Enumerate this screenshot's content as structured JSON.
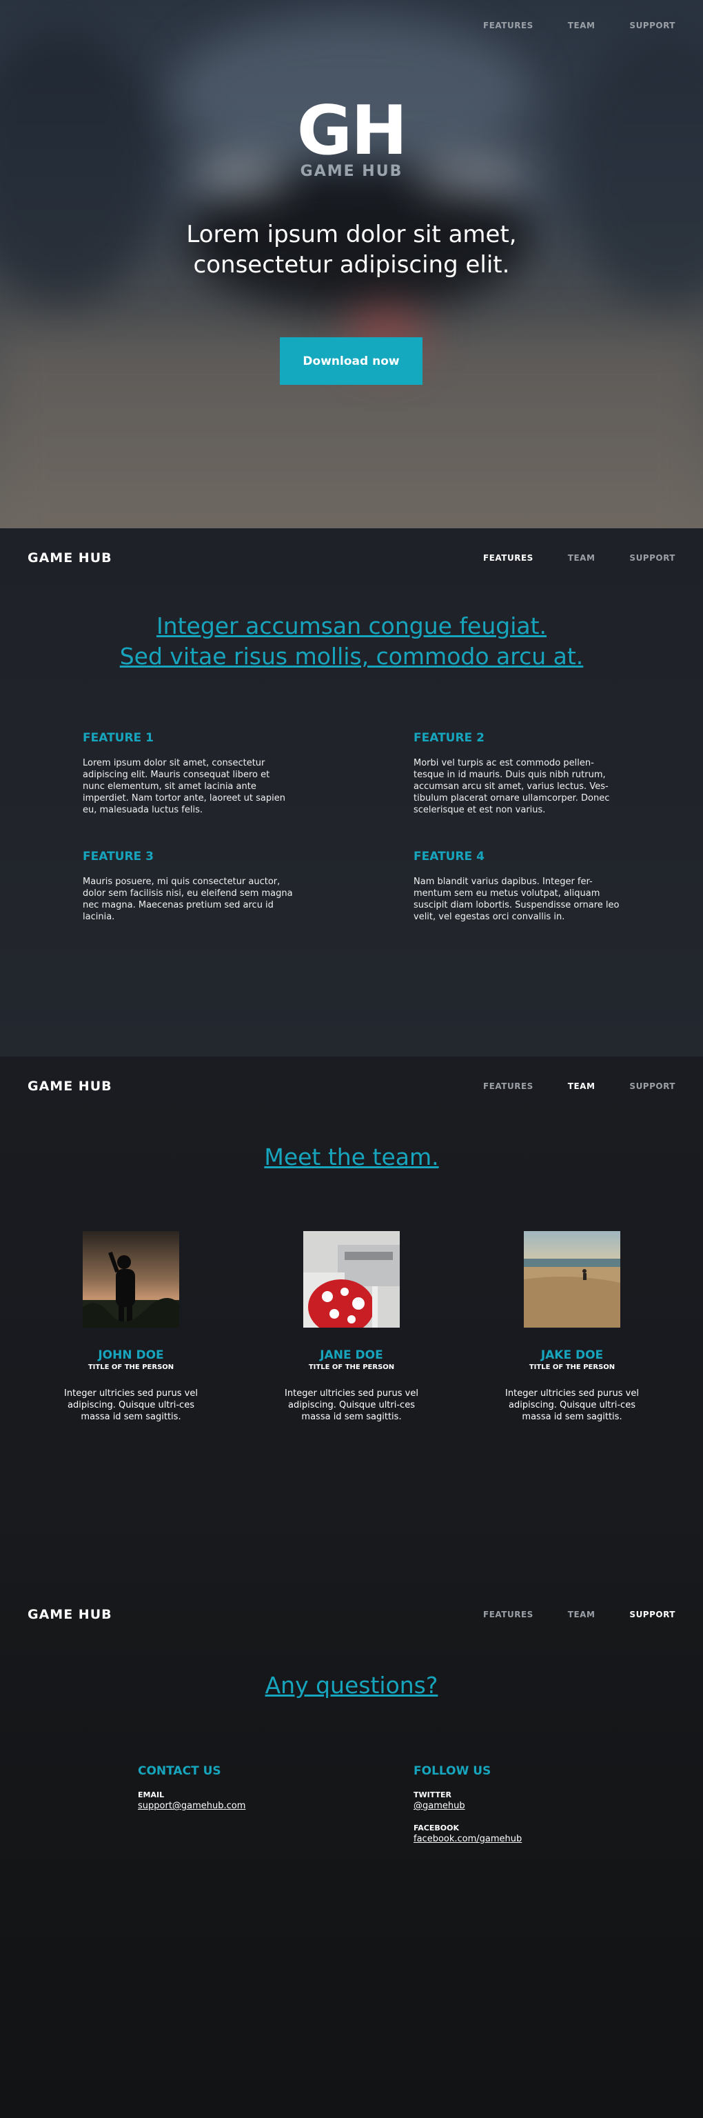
{
  "nav": {
    "features": "FEATURES",
    "team": "TEAM",
    "support": "SUPPORT"
  },
  "brand": "GAME HUB",
  "hero": {
    "logo_mark": "GH",
    "logo_text": "GAME HUB",
    "title_line1": "Lorem ipsum dolor sit amet,",
    "title_line2": "consectetur adipiscing elit.",
    "cta": "Download now"
  },
  "features": {
    "headline_line1": "Integer accumsan congue feugiat.",
    "headline_line2": "Sed vitae risus mollis, commodo arcu at.",
    "items": [
      {
        "title": "FEATURE 1",
        "text": "Lorem ipsum dolor sit amet, consectetur adipiscing elit. Mauris consequat libero et nunc elementum, sit amet lacinia ante imperdiet. Nam tortor ante, laoreet ut sapien eu, malesuada luctus felis."
      },
      {
        "title": "FEATURE 2",
        "text": "Morbi vel turpis ac est commodo pellen-tesque in id mauris. Duis quis nibh rutrum, accumsan arcu sit amet, varius lectus. Ves-tibulum placerat ornare ullamcorper. Donec scelerisque et est non varius."
      },
      {
        "title": "FEATURE 3",
        "text": "Mauris posuere, mi quis consectetur auctor, dolor sem facilisis nisi, eu eleifend sem magna nec magna. Maecenas pretium sed arcu id lacinia."
      },
      {
        "title": "FEATURE 4",
        "text": "Nam blandit varius dapibus. Integer fer-mentum sem eu metus volutpat, aliquam suscipit diam lobortis. Suspendisse ornare leo velit, vel egestas orci convallis in."
      }
    ]
  },
  "team": {
    "headline": "Meet the team.",
    "members": [
      {
        "name": "JOHN DOE",
        "role": "TITLE OF THE PERSON",
        "bio": "Integer ultricies sed purus vel adipiscing. Quisque ultri-ces massa id sem sagittis."
      },
      {
        "name": "JANE DOE",
        "role": "TITLE OF THE PERSON",
        "bio": "Integer ultricies sed purus vel adipiscing. Quisque ultri-ces massa id sem sagittis."
      },
      {
        "name": "JAKE DOE",
        "role": "TITLE OF THE PERSON",
        "bio": "Integer ultricies sed purus vel adipiscing. Quisque ultri-ces massa id sem sagittis."
      }
    ]
  },
  "contact": {
    "headline": "Any questions?",
    "contact_title": "CONTACT US",
    "email_label": "EMAIL",
    "email": "support@gamehub.com",
    "follow_title": "FOLLOW US",
    "twitter_label": "TWITTER",
    "twitter": "@gamehub",
    "facebook_label": "FACEBOOK",
    "facebook": "facebook.com/gamehub"
  },
  "colors": {
    "accent": "#17a5be",
    "button": "#15a9c0",
    "background": "#1e2127"
  }
}
